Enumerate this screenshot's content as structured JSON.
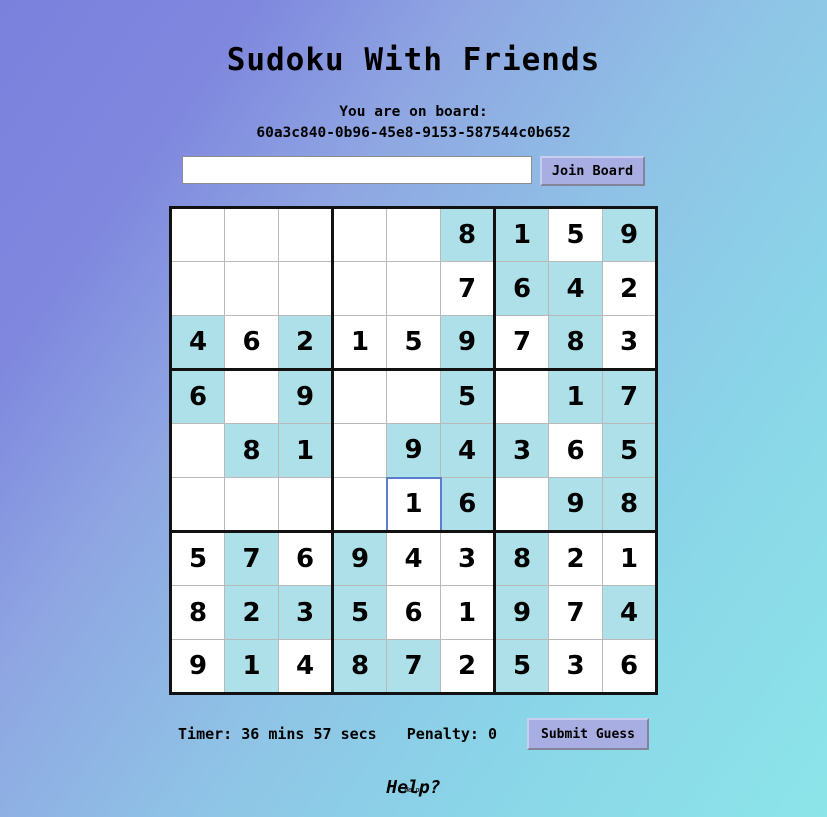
{
  "header": {
    "title": "Sudoku With Friends",
    "board_label": "You are on board:",
    "board_id": "60a3c840-0b96-45e8-9153-587544c0b652"
  },
  "join": {
    "input_value": "",
    "placeholder": "",
    "button_label": "Join Board"
  },
  "footer": {
    "timer": "Timer: 36 mins 57 secs",
    "penalty": "Penalty: 0",
    "submit_label": "Submit Guess",
    "help_label": "Help?",
    "help_ghost": "Help?"
  },
  "colors": {
    "locked_cell": "#ade0e8",
    "empty_cell": "#ffffff",
    "selected_border": "#5a7fd0",
    "grid_line": "#b9b9b9",
    "block_line": "#111111",
    "button": "#a9aee2",
    "bg_start": "#7a81dd",
    "bg_end": "#8ce5e9"
  },
  "board": {
    "size": 9,
    "rows": [
      [
        {
          "v": "",
          "locked": false,
          "selected": false
        },
        {
          "v": "",
          "locked": false,
          "selected": false
        },
        {
          "v": "",
          "locked": false,
          "selected": false
        },
        {
          "v": "",
          "locked": false,
          "selected": false
        },
        {
          "v": "",
          "locked": false,
          "selected": false
        },
        {
          "v": "8",
          "locked": true,
          "selected": false
        },
        {
          "v": "1",
          "locked": true,
          "selected": false
        },
        {
          "v": "5",
          "locked": false,
          "selected": false
        },
        {
          "v": "9",
          "locked": true,
          "selected": false
        }
      ],
      [
        {
          "v": "",
          "locked": false,
          "selected": false
        },
        {
          "v": "",
          "locked": false,
          "selected": false
        },
        {
          "v": "",
          "locked": false,
          "selected": false
        },
        {
          "v": "",
          "locked": false,
          "selected": false
        },
        {
          "v": "",
          "locked": false,
          "selected": false
        },
        {
          "v": "7",
          "locked": false,
          "selected": false
        },
        {
          "v": "6",
          "locked": true,
          "selected": false
        },
        {
          "v": "4",
          "locked": true,
          "selected": false
        },
        {
          "v": "2",
          "locked": false,
          "selected": false
        }
      ],
      [
        {
          "v": "4",
          "locked": true,
          "selected": false
        },
        {
          "v": "6",
          "locked": false,
          "selected": false
        },
        {
          "v": "2",
          "locked": true,
          "selected": false
        },
        {
          "v": "1",
          "locked": false,
          "selected": false
        },
        {
          "v": "5",
          "locked": false,
          "selected": false
        },
        {
          "v": "9",
          "locked": true,
          "selected": false
        },
        {
          "v": "7",
          "locked": false,
          "selected": false
        },
        {
          "v": "8",
          "locked": true,
          "selected": false
        },
        {
          "v": "3",
          "locked": false,
          "selected": false
        }
      ],
      [
        {
          "v": "6",
          "locked": true,
          "selected": false
        },
        {
          "v": "",
          "locked": false,
          "selected": false
        },
        {
          "v": "9",
          "locked": true,
          "selected": false
        },
        {
          "v": "",
          "locked": false,
          "selected": false
        },
        {
          "v": "",
          "locked": false,
          "selected": false
        },
        {
          "v": "5",
          "locked": true,
          "selected": false
        },
        {
          "v": "",
          "locked": false,
          "selected": false
        },
        {
          "v": "1",
          "locked": true,
          "selected": false
        },
        {
          "v": "7",
          "locked": true,
          "selected": false
        }
      ],
      [
        {
          "v": "",
          "locked": false,
          "selected": false
        },
        {
          "v": "8",
          "locked": true,
          "selected": false
        },
        {
          "v": "1",
          "locked": true,
          "selected": false
        },
        {
          "v": "",
          "locked": false,
          "selected": false
        },
        {
          "v": "9",
          "locked": true,
          "selected": false
        },
        {
          "v": "4",
          "locked": true,
          "selected": false
        },
        {
          "v": "3",
          "locked": true,
          "selected": false
        },
        {
          "v": "6",
          "locked": false,
          "selected": false
        },
        {
          "v": "5",
          "locked": true,
          "selected": false
        }
      ],
      [
        {
          "v": "",
          "locked": false,
          "selected": false
        },
        {
          "v": "",
          "locked": false,
          "selected": false
        },
        {
          "v": "",
          "locked": false,
          "selected": false
        },
        {
          "v": "",
          "locked": false,
          "selected": false
        },
        {
          "v": "1",
          "locked": false,
          "selected": true
        },
        {
          "v": "6",
          "locked": true,
          "selected": false
        },
        {
          "v": "",
          "locked": false,
          "selected": false
        },
        {
          "v": "9",
          "locked": true,
          "selected": false
        },
        {
          "v": "8",
          "locked": true,
          "selected": false
        }
      ],
      [
        {
          "v": "5",
          "locked": false,
          "selected": false
        },
        {
          "v": "7",
          "locked": true,
          "selected": false
        },
        {
          "v": "6",
          "locked": false,
          "selected": false
        },
        {
          "v": "9",
          "locked": true,
          "selected": false
        },
        {
          "v": "4",
          "locked": false,
          "selected": false
        },
        {
          "v": "3",
          "locked": false,
          "selected": false
        },
        {
          "v": "8",
          "locked": true,
          "selected": false
        },
        {
          "v": "2",
          "locked": false,
          "selected": false
        },
        {
          "v": "1",
          "locked": false,
          "selected": false
        }
      ],
      [
        {
          "v": "8",
          "locked": false,
          "selected": false
        },
        {
          "v": "2",
          "locked": true,
          "selected": false
        },
        {
          "v": "3",
          "locked": true,
          "selected": false
        },
        {
          "v": "5",
          "locked": true,
          "selected": false
        },
        {
          "v": "6",
          "locked": false,
          "selected": false
        },
        {
          "v": "1",
          "locked": false,
          "selected": false
        },
        {
          "v": "9",
          "locked": true,
          "selected": false
        },
        {
          "v": "7",
          "locked": false,
          "selected": false
        },
        {
          "v": "4",
          "locked": true,
          "selected": false
        }
      ],
      [
        {
          "v": "9",
          "locked": false,
          "selected": false
        },
        {
          "v": "1",
          "locked": true,
          "selected": false
        },
        {
          "v": "4",
          "locked": false,
          "selected": false
        },
        {
          "v": "8",
          "locked": true,
          "selected": false
        },
        {
          "v": "7",
          "locked": true,
          "selected": false
        },
        {
          "v": "2",
          "locked": false,
          "selected": false
        },
        {
          "v": "5",
          "locked": true,
          "selected": false
        },
        {
          "v": "3",
          "locked": false,
          "selected": false
        },
        {
          "v": "6",
          "locked": false,
          "selected": false
        }
      ]
    ]
  }
}
